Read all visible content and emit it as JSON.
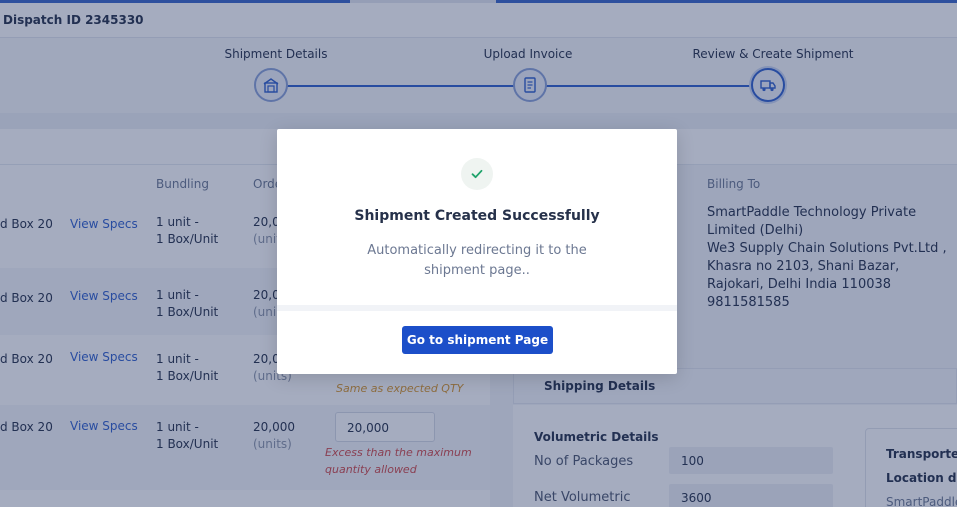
{
  "header": {
    "dispatch_title": "Dispatch ID 2345330"
  },
  "stepper": {
    "steps": [
      {
        "label": "Shipment Details"
      },
      {
        "label": "Upload Invoice"
      },
      {
        "label": "Review & Create Shipment"
      }
    ]
  },
  "table": {
    "columns": {
      "bundling": "Bundling",
      "ordered": "Orde"
    },
    "rows": [
      {
        "product": "d Box 20",
        "specs": "View Specs",
        "bundling_line1": "1 unit -",
        "bundling_line2": "1 Box/Unit",
        "ordered": "20,0",
        "unit": "(unit"
      },
      {
        "product": "d Box 20",
        "specs": "View Specs",
        "bundling_line1": "1 unit -",
        "bundling_line2": "1 Box/Unit",
        "ordered": "20,0",
        "unit": "(uni"
      },
      {
        "product": "d Box 20",
        "specs": "View Specs",
        "bundling_line1": "1 unit -",
        "bundling_line2": "1 Box/Unit",
        "ordered": "20,0",
        "unit": "(units)",
        "hint": "Same as expected QTY"
      },
      {
        "product": "d Box 20",
        "specs": "View Specs",
        "bundling_line1": "1 unit -",
        "bundling_line2": "1 Box/Unit",
        "ordered": "20,000",
        "unit": "(units)",
        "qty_value": "20,000",
        "error_line1": "Excess than the maximum",
        "error_line2": "quantity allowed"
      }
    ]
  },
  "billing": {
    "heading": "Billing To",
    "lines": [
      "SmartPaddle Technology Private",
      "Limited (Delhi)",
      "We3 Supply Chain Solutions Pvt.Ltd ,",
      "Khasra no 2103,  Shani Bazar,",
      "Rajokari, Delhi India 110038",
      "9811581585"
    ]
  },
  "shipping": {
    "title": "Shipping Details",
    "volumetric_title": "Volumetric Details",
    "packages_label": "No of Packages",
    "packages_value": "100",
    "net_label": "Net Volumetric",
    "net_value": "3600",
    "transporter_label": "Transporter",
    "location_label": "Location det",
    "location_value": "SmartPaddle"
  },
  "modal": {
    "title": "Shipment Created Successfully",
    "message": "Automatically redirecting it to the shipment page..",
    "button": "Go to shipment Page"
  },
  "colors": {
    "primary": "#1c4fc9",
    "link": "#2f5fcc",
    "success": "#1fa36b",
    "warning": "#d9962a",
    "error": "#d24b4b"
  },
  "icons": {
    "step1": "warehouse-icon",
    "step2": "invoice-icon",
    "step3": "truck-icon",
    "modal": "checkmark-icon"
  }
}
